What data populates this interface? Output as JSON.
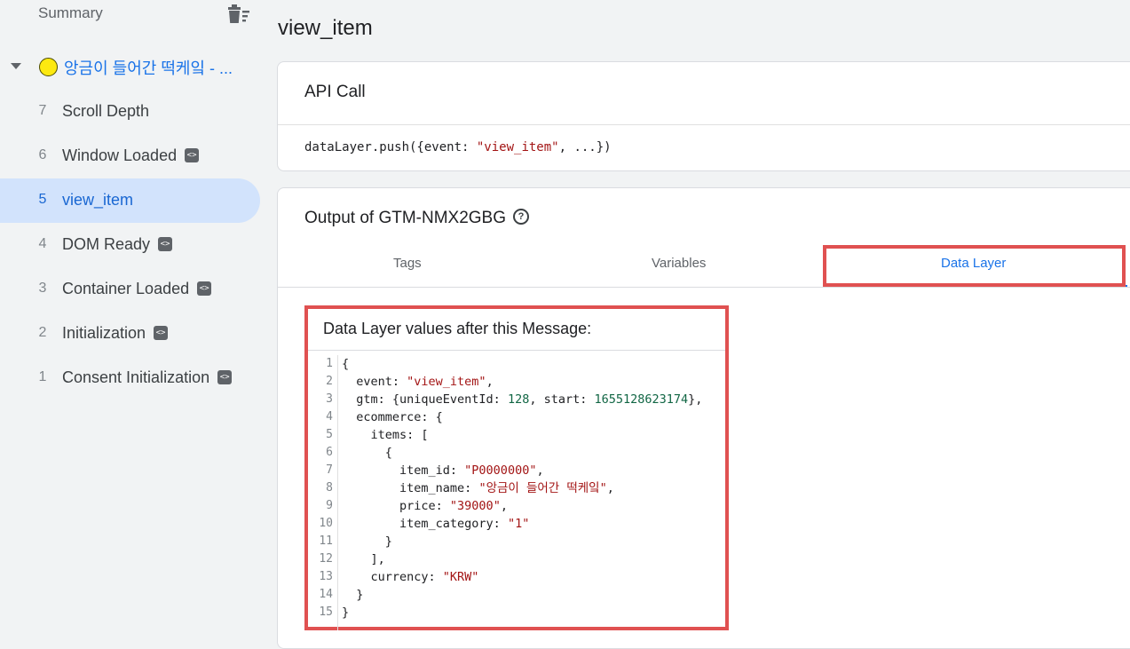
{
  "sidebar": {
    "summary_label": "Summary",
    "page_label": "앙금이 들어간 떡케잌 - ...",
    "events": [
      {
        "num": "7",
        "name": "Scroll Depth",
        "code_icon": false
      },
      {
        "num": "6",
        "name": "Window Loaded",
        "code_icon": true
      },
      {
        "num": "5",
        "name": "view_item",
        "code_icon": false,
        "selected": true
      },
      {
        "num": "4",
        "name": "DOM Ready",
        "code_icon": true
      },
      {
        "num": "3",
        "name": "Container Loaded",
        "code_icon": true
      },
      {
        "num": "2",
        "name": "Initialization",
        "code_icon": true
      },
      {
        "num": "1",
        "name": "Consent Initialization",
        "code_icon": true
      }
    ]
  },
  "main": {
    "title": "view_item",
    "api_call": {
      "header": "API Call",
      "code_prefix": "dataLayer.push({event: ",
      "code_event": "\"view_item\"",
      "code_suffix": ", ...})"
    },
    "output": {
      "title": "Output of GTM-NMX2GBG",
      "tabs": [
        "Tags",
        "Variables",
        "Data Layer"
      ],
      "active_tab": "Data Layer",
      "data_layer_title": "Data Layer values after this Message:",
      "code_lines": [
        "{",
        "  event: \"view_item\",",
        "  gtm: {uniqueEventId: 128, start: 1655128623174},",
        "  ecommerce: {",
        "    items: [",
        "      {",
        "        item_id: \"P0000000\",",
        "        item_name: \"앙금이 들어간 떡케잌\",",
        "        price: \"39000\",",
        "        item_category: \"1\"",
        "      }",
        "    ],",
        "    currency: \"KRW\"",
        "  }",
        "}"
      ]
    }
  },
  "colors": {
    "accent": "#1a73e8",
    "highlight": "#e05151",
    "selected_bg": "#d2e3fc",
    "page_dot": "#fde910"
  }
}
